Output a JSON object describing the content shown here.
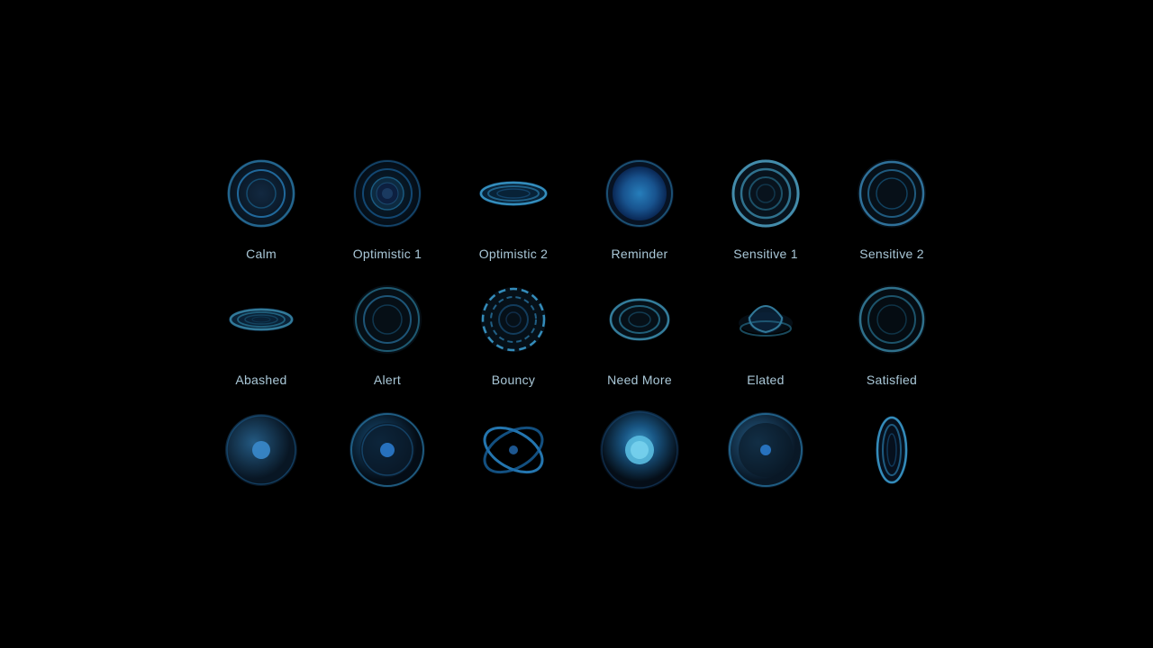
{
  "rows": [
    {
      "items": [
        {
          "id": "calm",
          "label": "Calm",
          "type": "calm"
        },
        {
          "id": "optimistic1",
          "label": "Optimistic 1",
          "type": "optimistic1"
        },
        {
          "id": "optimistic2",
          "label": "Optimistic 2",
          "type": "optimistic2"
        },
        {
          "id": "reminder",
          "label": "Reminder",
          "type": "reminder"
        },
        {
          "id": "sensitive1",
          "label": "Sensitive 1",
          "type": "sensitive1"
        },
        {
          "id": "sensitive2",
          "label": "Sensitive 2",
          "type": "sensitive2"
        }
      ]
    },
    {
      "items": [
        {
          "id": "abashed",
          "label": "Abashed",
          "type": "abashed"
        },
        {
          "id": "alert",
          "label": "Alert",
          "type": "alert"
        },
        {
          "id": "bouncy",
          "label": "Bouncy",
          "type": "bouncy"
        },
        {
          "id": "needmore",
          "label": "Need More",
          "type": "needmore"
        },
        {
          "id": "elated",
          "label": "Elated",
          "type": "elated"
        },
        {
          "id": "satisfied",
          "label": "Satisfied",
          "type": "satisfied"
        }
      ]
    },
    {
      "items": [
        {
          "id": "r3c1",
          "label": "",
          "type": "r3c1"
        },
        {
          "id": "r3c2",
          "label": "",
          "type": "r3c2"
        },
        {
          "id": "r3c3",
          "label": "",
          "type": "r3c3"
        },
        {
          "id": "r3c4",
          "label": "",
          "type": "r3c4"
        },
        {
          "id": "r3c5",
          "label": "",
          "type": "r3c5"
        },
        {
          "id": "r3c6",
          "label": "",
          "type": "r3c6"
        }
      ]
    }
  ]
}
